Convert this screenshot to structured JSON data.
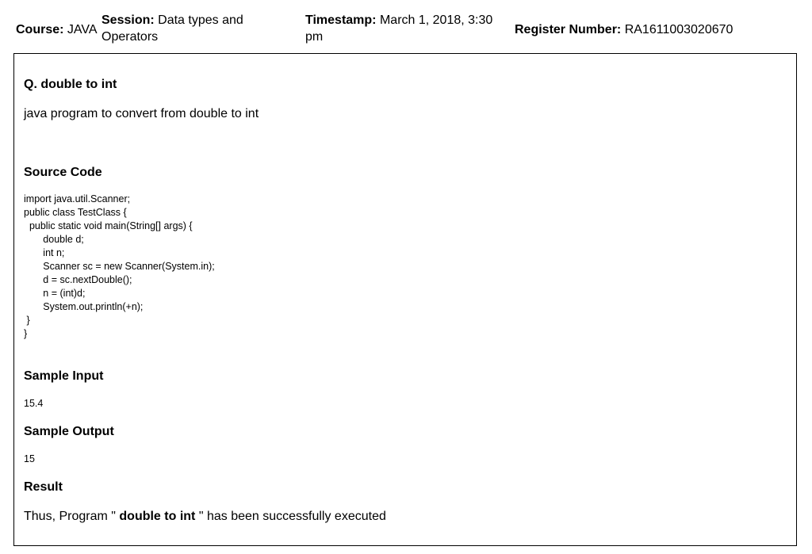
{
  "header": {
    "course_label": "Course:",
    "course_value": "JAVA",
    "session_label": "Session:",
    "session_value": "Data types and Operators",
    "timestamp_label": "Timestamp:",
    "timestamp_value": "March 1, 2018, 3:30 pm",
    "register_label": "Register Number:",
    "register_value": "RA1611003020670"
  },
  "question": {
    "title": "Q. double to int",
    "description": "java program to convert from double to int"
  },
  "source_code": {
    "heading": "Source Code",
    "lines": [
      "import java.util.Scanner;",
      "public class TestClass {",
      "  public static void main(String[] args) {",
      "       double d;",
      "       int n;",
      "       Scanner sc = new Scanner(System.in);",
      "       d = sc.nextDouble();",
      "       n = (int)d;",
      "       System.out.println(+n);",
      " }",
      "}"
    ]
  },
  "sample_input": {
    "heading": "Sample Input",
    "value": "15.4"
  },
  "sample_output": {
    "heading": "Sample Output",
    "value": "15"
  },
  "result": {
    "heading": "Result",
    "prefix": "Thus, Program \" ",
    "program_name": "double to int",
    "suffix": " \" has been successfully executed"
  }
}
